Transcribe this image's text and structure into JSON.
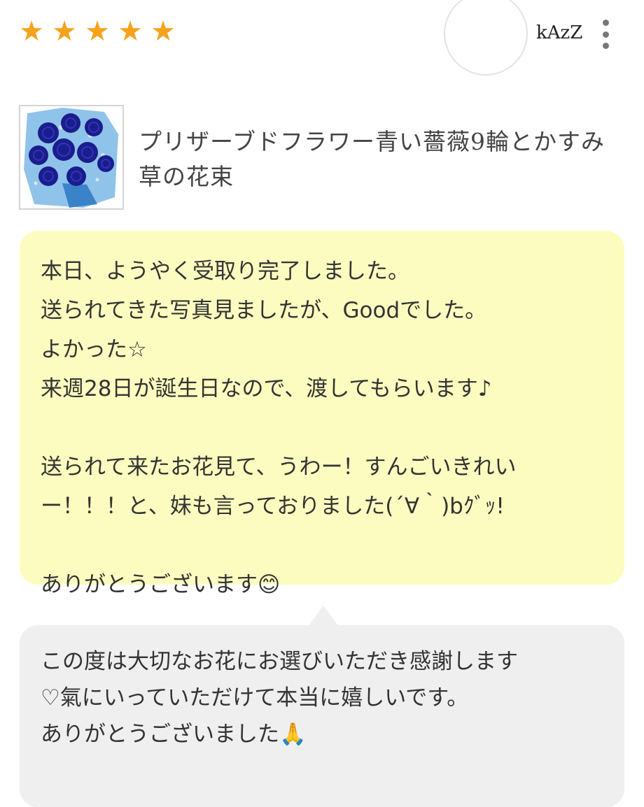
{
  "rating": {
    "stars": 5,
    "star_glyph": "★",
    "color": "#f7a21b"
  },
  "reviewer": {
    "username": "kAzZ",
    "menu_icon": "more-vertical-icon"
  },
  "product": {
    "image_alt": "blue-rose-bouquet",
    "title": "プリザーブドフラワー青い薔薇9輪とかすみ草の花束"
  },
  "review": {
    "background": "#fdfcc0",
    "lines": [
      "本日、ようやく受取り完了しました。",
      "送られてきた写真見ましたが、Goodでした。",
      "よかった☆",
      "来週28日が誕生日なので、渡してもらいます♪",
      "送られて来たお花見て、うわー！すんごいきれい",
      "ー！！！と、妹も言っておりました(´∀｀)bｸﾞｯ!",
      "ありがとうございます😊"
    ]
  },
  "reply": {
    "background": "#efefef",
    "lines": [
      "この度は大切なお花にお選びいただき感謝します",
      "♡氣にいっていただけて本当に嬉しいです。",
      "ありがとうございました🙏"
    ]
  }
}
